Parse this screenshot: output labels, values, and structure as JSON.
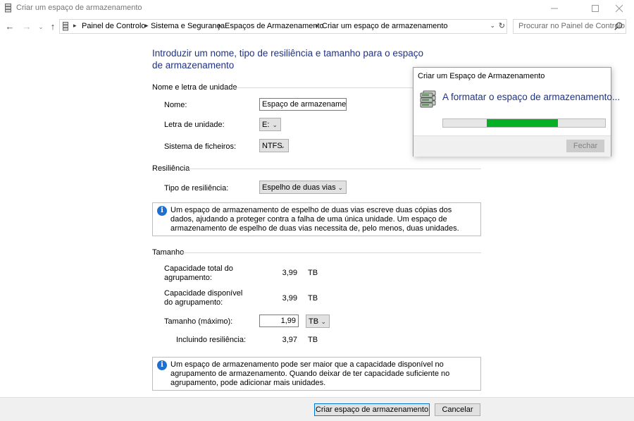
{
  "window": {
    "title": "Criar um espaço de armazenamento"
  },
  "address_bar": {
    "breadcrumbs": [
      "Painel de Controlo",
      "Sistema e Segurança",
      "Espaços de Armazenamento",
      "Criar um espaço de armazenamento"
    ],
    "search_placeholder": "Procurar no Painel de Controlo"
  },
  "main": {
    "heading": "Introduzir um nome, tipo de resiliência e tamanho para o espaço de armazenamento",
    "name_section": {
      "title": "Nome e letra de unidade",
      "name_label": "Nome:",
      "name_value": "Espaço de armazenamento",
      "drive_letter_label": "Letra de unidade:",
      "drive_letter_value": "E:",
      "filesystem_label": "Sistema de ficheiros:",
      "filesystem_value": "NTFS"
    },
    "resiliency_section": {
      "title": "Resiliência",
      "type_label": "Tipo de resiliência:",
      "type_value": "Espelho de duas vias",
      "info": "Um espaço de armazenamento de espelho de duas vias escreve duas cópias dos dados, ajudando a proteger contra a falha de uma única unidade. Um espaço de armazenamento de espelho de duas vias necessita de, pelo menos, duas unidades."
    },
    "size_section": {
      "title": "Tamanho",
      "total_capacity_label": "Capacidade total do agrupamento:",
      "total_capacity_value": "3,99",
      "total_capacity_unit": "TB",
      "available_capacity_label": "Capacidade disponível do agrupamento:",
      "available_capacity_value": "3,99",
      "available_capacity_unit": "TB",
      "size_label": "Tamanho (máximo):",
      "size_value": "1,99",
      "size_unit": "TB",
      "including_label": "Incluindo resiliência:",
      "including_value": "3,97",
      "including_unit": "TB",
      "info": "Um espaço de armazenamento pode ser maior que a capacidade disponível no agrupamento de armazenamento. Quando deixar de ter capacidade suficiente no agrupamento, pode adicionar mais unidades."
    }
  },
  "footer": {
    "create_label": "Criar espaço de armazenamento",
    "cancel_label": "Cancelar"
  },
  "dialog": {
    "title": "Criar um Espaço de Armazenamento",
    "heading": "A formatar o espaço de armazenamento...",
    "progress_start": 0.27,
    "progress_end": 0.71,
    "close_label": "Fechar",
    "progress_color": "#06b025"
  },
  "colors": {
    "heading": "#1e3287",
    "info_icon": "#1f6fd1"
  }
}
